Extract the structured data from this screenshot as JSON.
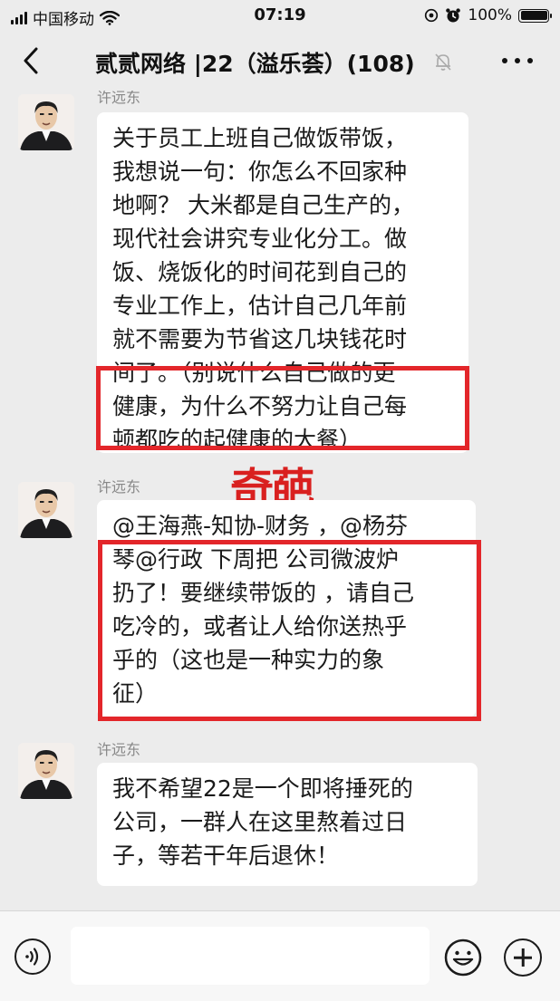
{
  "status_bar": {
    "carrier": "中国移动",
    "time": "07:19",
    "battery": "100%",
    "battery_level": 1.0,
    "icons": [
      "signal-icon",
      "wifi-icon",
      "location-icon",
      "alarm-icon",
      "battery-icon"
    ]
  },
  "nav": {
    "title": "贰贰网络 |22（溢乐荟）(108)",
    "back_icon": "chevron-left-icon",
    "mute_icon": "bell-muted-icon",
    "more_icon": "more-dots-icon"
  },
  "messages": [
    {
      "sender": "许远东",
      "lines": [
        "关于员工上班自己做饭带饭，",
        "我想说一句：你怎么不回家种",
        "地啊？ 大米都是自己生产的，",
        "现代社会讲究专业化分工。做",
        "饭、烧饭化的时间花到自己的",
        "专业工作上，估计自己几年前",
        "就不需要为节省这几块钱花时",
        "间了。（别说什么自己做的更",
        "健康，为什么不努力让自己每",
        "顿都吃的起健康的大餐）"
      ]
    },
    {
      "sender": "许远东",
      "lines": [
        "@王海燕-知协-财务 ，@杨芬",
        "琴@行政  下周把 公司微波炉",
        "扔了！要继续带饭的 ，请自己",
        "吃冷的，或者让人给你送热乎",
        "乎的（这也是一种实力的象",
        "征）"
      ]
    },
    {
      "sender": "许远东",
      "lines": [
        "我不希望22是一个即将捶死的",
        "公司，一群人在这里熬着过日",
        "子，等若干年后退休！"
      ]
    }
  ],
  "watermark": "奇葩",
  "highlight_color": "#e3262a",
  "input_bar": {
    "placeholder": "",
    "voice_icon": "voice-icon",
    "emoji_icon": "emoji-icon",
    "plus_icon": "plus-icon"
  }
}
